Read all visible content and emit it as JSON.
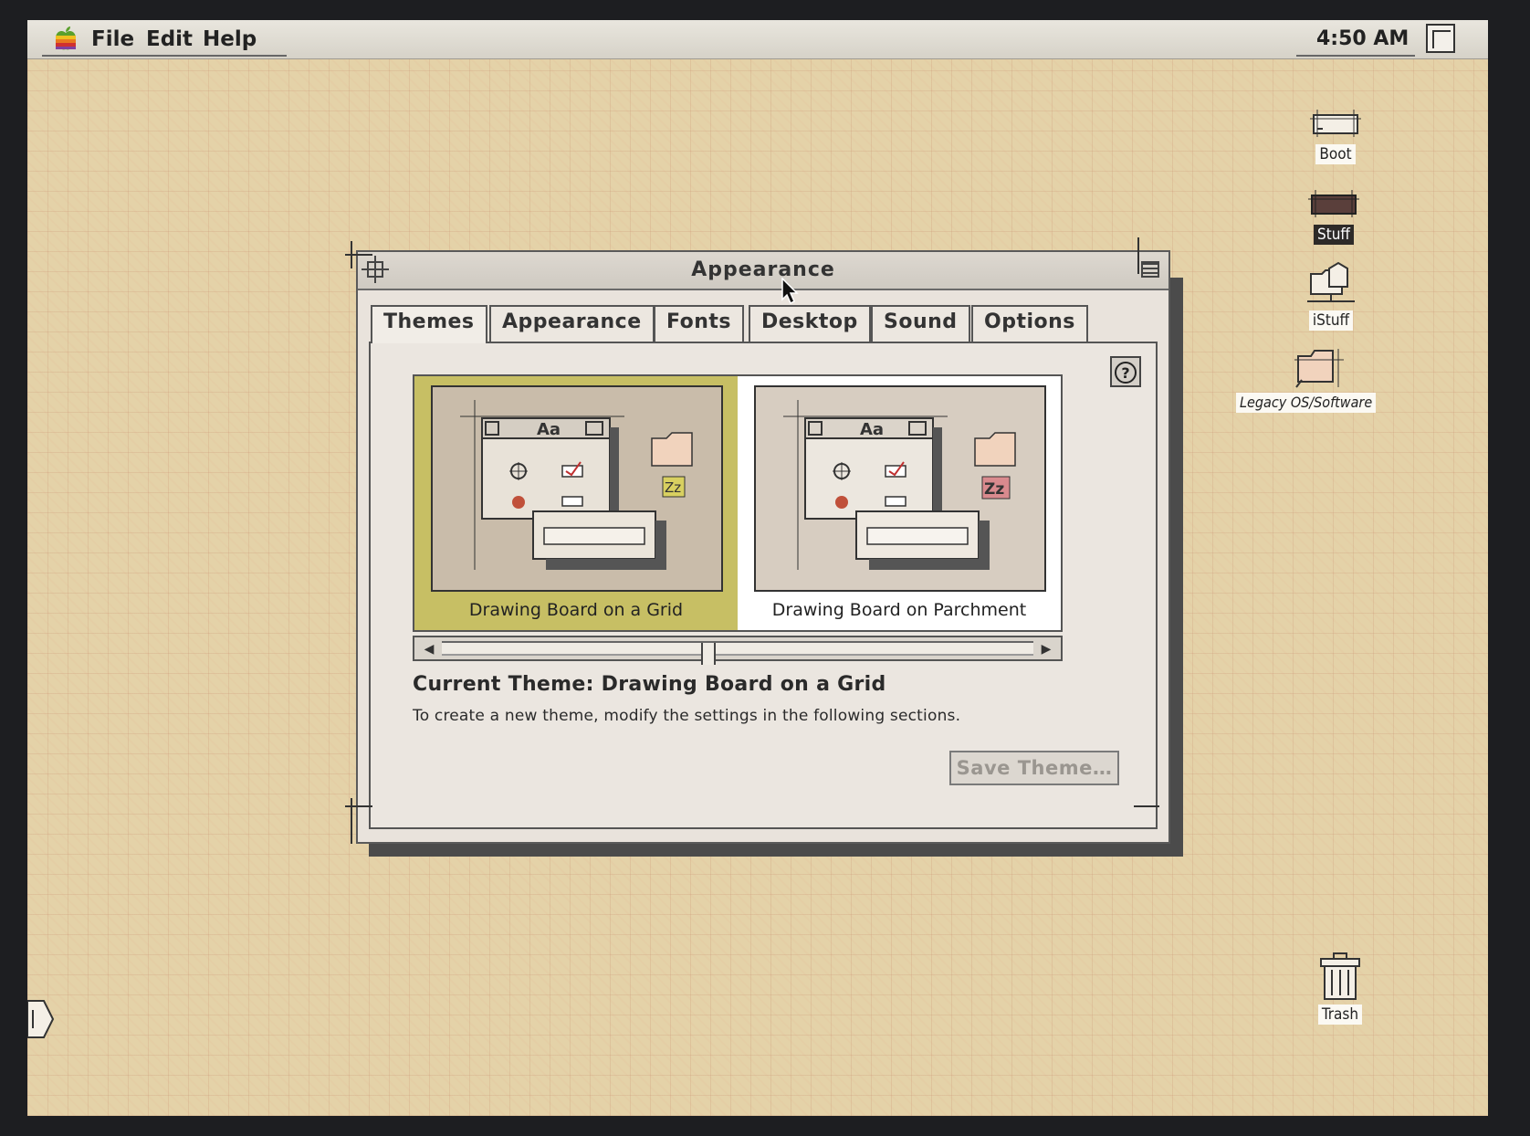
{
  "menubar": {
    "items": [
      "File",
      "Edit",
      "Help"
    ],
    "clock": "4:50 AM"
  },
  "desktop": {
    "icons": [
      {
        "label": "Boot",
        "icon": "hard-disk-icon"
      },
      {
        "label": "Stuff",
        "icon": "disk-icon",
        "selected": true
      },
      {
        "label": "iStuff",
        "icon": "network-folder-icon"
      },
      {
        "label": "Legacy OS/Software",
        "icon": "alias-folder-icon"
      },
      {
        "label": "Trash",
        "icon": "trash-icon"
      }
    ]
  },
  "window": {
    "title": "Appearance",
    "tabs": [
      "Themes",
      "Appearance",
      "Fonts",
      "Desktop",
      "Sound",
      "Options"
    ],
    "active_tab": "Themes",
    "help_label": "?",
    "themes": [
      {
        "name": "Drawing Board on a Grid",
        "selected": true,
        "accent": "#c7bf64"
      },
      {
        "name": "Drawing Board on Parchment",
        "selected": false,
        "accent": "#ffffff"
      }
    ],
    "current_theme": "Current Theme: Drawing Board on a Grid",
    "hint": "To create a new theme, modify the settings in the following sections.",
    "save_button": "Save Theme…",
    "scroll_position": 0.45
  }
}
